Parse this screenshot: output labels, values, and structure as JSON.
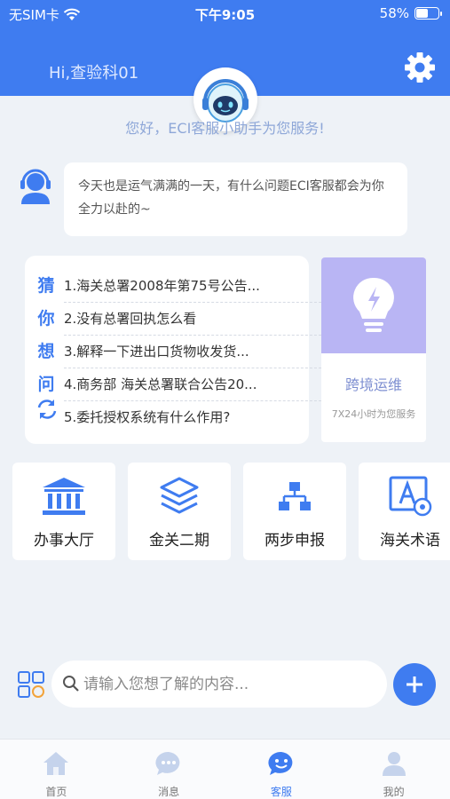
{
  "status_bar": {
    "carrier": "无SIM卡",
    "time": "下午9:05",
    "battery": "58%",
    "battery_level": 0.58
  },
  "header": {
    "greeting": "Hi,查验科01"
  },
  "welcome_text": "您好，ECI客服小助手为您服务!",
  "chat": {
    "message": "今天也是运气满满的一天，有什么问题ECI客服都会为你全力以赴的~"
  },
  "guess": {
    "title_chars": [
      "猜",
      "你",
      "想",
      "问"
    ],
    "questions": [
      "1.海关总署2008年第75号公告...",
      "2.没有总署回执怎么看",
      "3.解释一下进出口货物收发货...",
      "4.商务部 海关总署联合公告20...",
      "5.委托授权系统有什么作用?"
    ]
  },
  "cross_border": {
    "title": "跨境运维",
    "subtitle": "7X24小时为您服务"
  },
  "quick_tiles": [
    {
      "label": "办事大厅",
      "icon": "bank-icon"
    },
    {
      "label": "金关二期",
      "icon": "layers-icon"
    },
    {
      "label": "两步申报",
      "icon": "org-chart-icon"
    },
    {
      "label": "海关术语",
      "icon": "glossary-icon"
    }
  ],
  "input": {
    "placeholder": "请输入您想了解的内容..."
  },
  "tabs": [
    {
      "label": "首页",
      "icon": "home-icon"
    },
    {
      "label": "消息",
      "icon": "message-icon"
    },
    {
      "label": "客服",
      "icon": "service-icon",
      "active": true
    },
    {
      "label": "我的",
      "icon": "user-icon"
    }
  ],
  "colors": {
    "primary": "#3f7cf0",
    "background": "#eef2f7",
    "cross_card": "#b9b5f4"
  }
}
